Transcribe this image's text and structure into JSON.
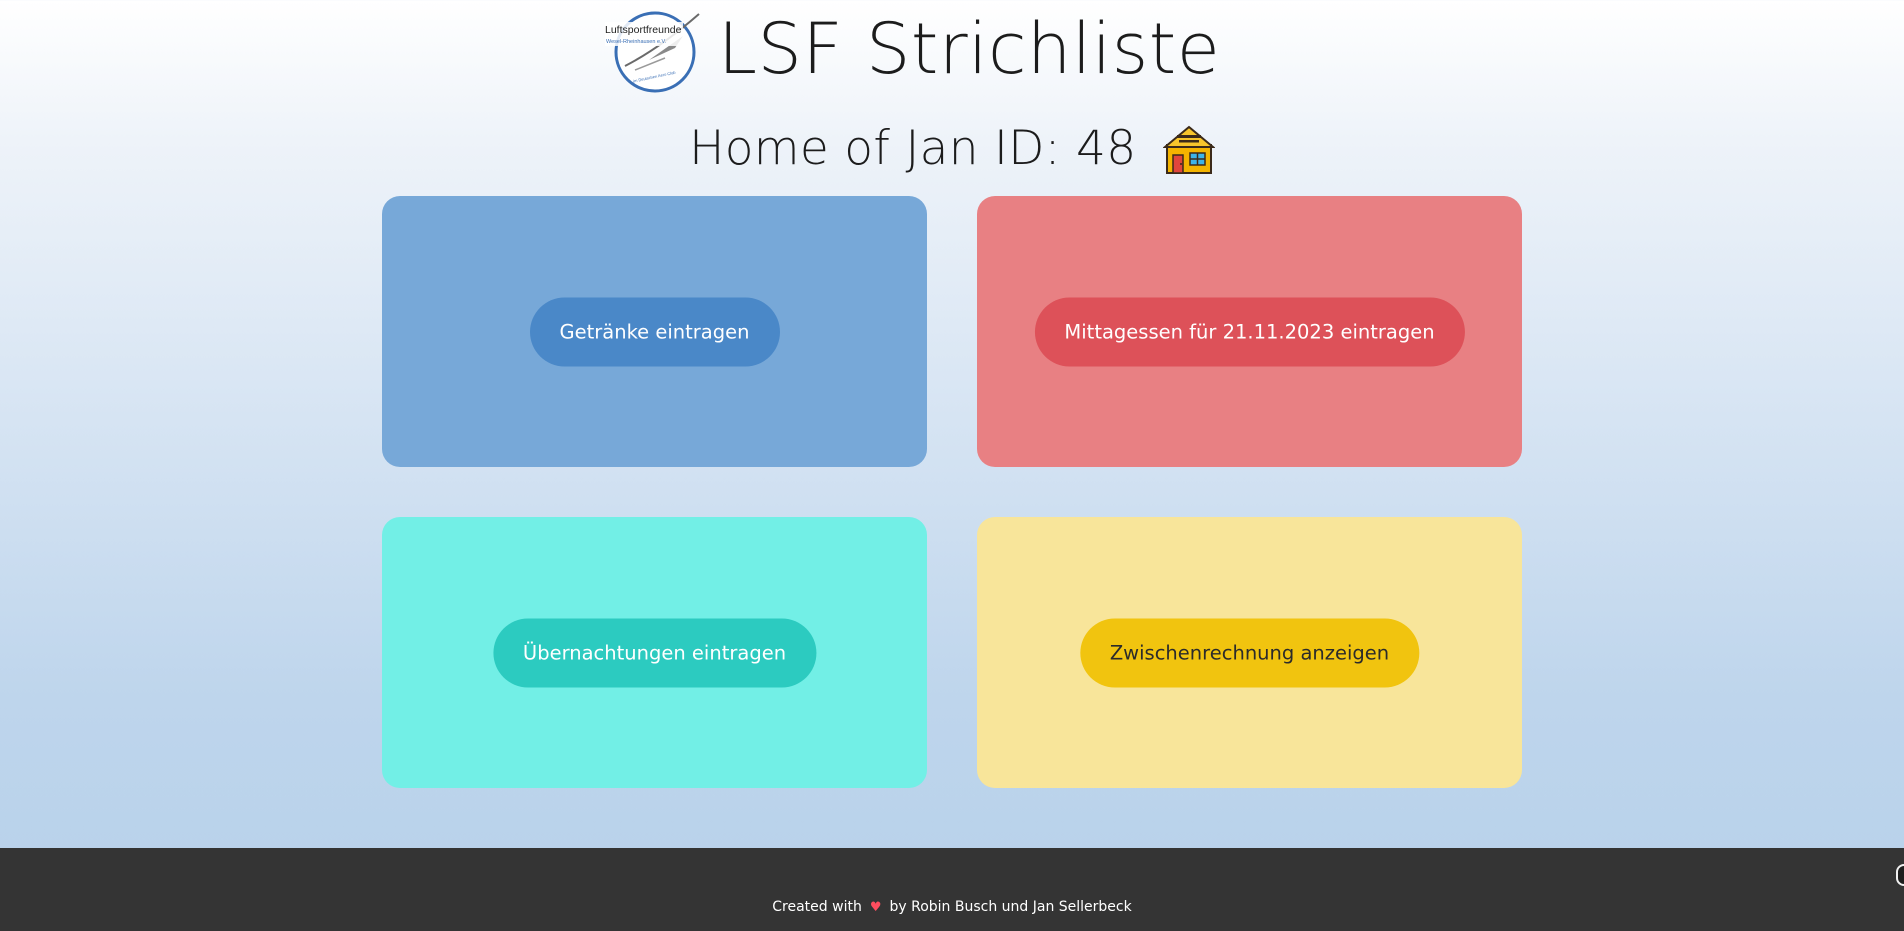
{
  "header": {
    "app_title": "LSF Strichliste",
    "logo": {
      "icon": "glider-club-logo-icon",
      "club_name": "Luftsportfreunde",
      "subtitle": "Wesel-Rheinhausen e.V.",
      "ring_text": "im Deutschen Aero Club"
    }
  },
  "home": {
    "text": "Home of Jan ID: 48",
    "icon": "house-icon"
  },
  "cards": {
    "drinks": {
      "button_label": "Getränke eintragen",
      "color": "#77a8d8",
      "button_color": "#4a88c8"
    },
    "lunch": {
      "button_label": "Mittagessen für 21.11.2023 eintragen",
      "color": "#e88083",
      "button_color": "#dd5159"
    },
    "overnight": {
      "button_label": "Übernachtungen eintragen",
      "color": "#72efe6",
      "button_color": "#2ccbc0"
    },
    "bill": {
      "button_label": "Zwischenrechnung anzeigen",
      "color": "#f8e59a",
      "button_color": "#f1c40f"
    }
  },
  "footer": {
    "created_with": "Created with",
    "heart_icon": "heart-icon",
    "authors": "by Robin Busch und Jan Sellerbeck",
    "background": "#343434"
  }
}
